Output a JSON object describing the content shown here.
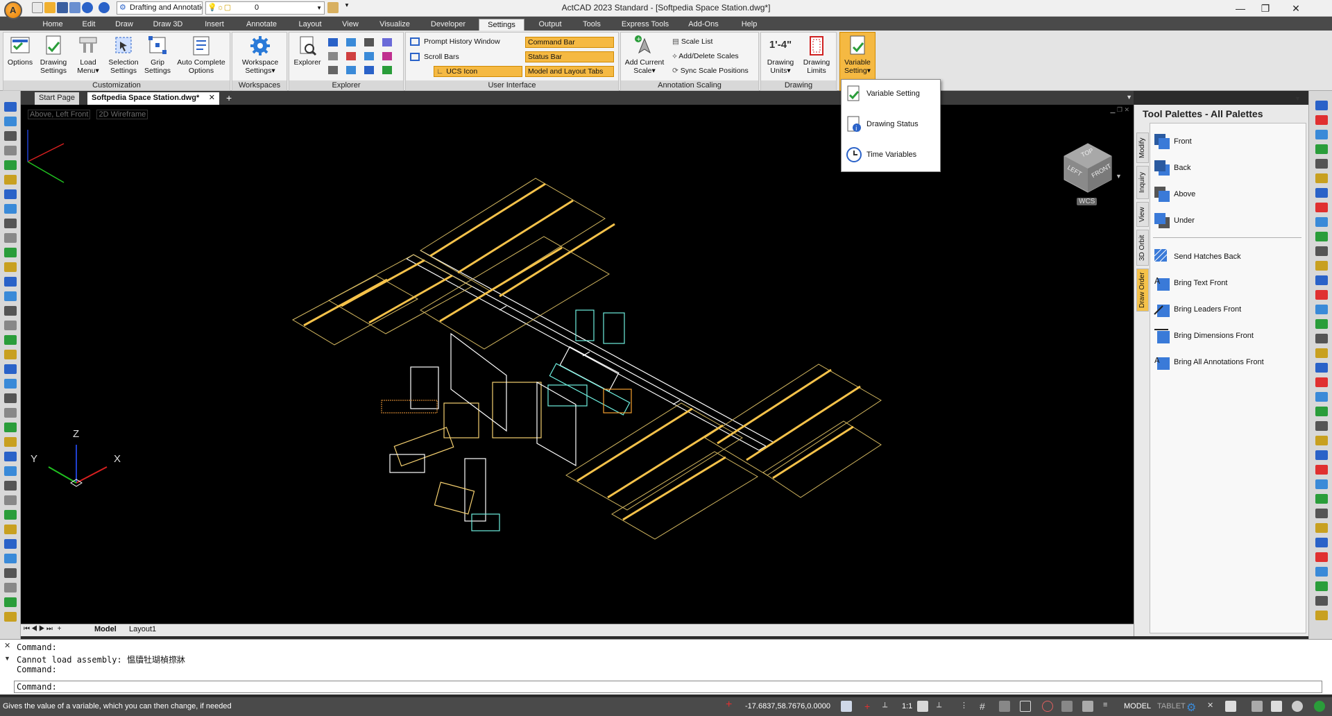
{
  "window": {
    "title": "ActCAD 2023 Standard - [Softpedia Space Station.dwg*]",
    "minimize": "—",
    "maximize": "❐",
    "close": "✕"
  },
  "quick_access": {
    "workspace_value": "Drafting and Annotation",
    "layer_value": "0"
  },
  "ribbon_tabs": [
    "Home",
    "Edit",
    "Draw",
    "Draw 3D",
    "Insert",
    "Annotate",
    "Layout",
    "View",
    "Visualize",
    "Developer",
    "Settings",
    "Output",
    "Tools",
    "Express Tools",
    "Add-Ons",
    "Help"
  ],
  "active_tab": "Settings",
  "ribbon": {
    "customization": {
      "label": "Customization",
      "buttons": [
        "Options",
        "Drawing\nSettings",
        "Load\nMenu▾",
        "Selection\nSettings",
        "Grip\nSettings",
        "Auto Complete\nOptions"
      ]
    },
    "workspaces": {
      "label": "Workspaces",
      "button": "Workspace\nSettings▾"
    },
    "explorer": {
      "label": "Explorer",
      "button": "Explorer"
    },
    "user_interface": {
      "label": "User Interface",
      "items": [
        "Prompt History Window",
        "Scroll Bars",
        "UCS Icon",
        "Command Bar",
        "Status Bar",
        "Model and Layout Tabs"
      ]
    },
    "annotation_scaling": {
      "label": "Annotation Scaling",
      "big": "Add Current\nScale▾",
      "items": [
        "Scale List",
        "Add/Delete Scales",
        "Sync Scale Positions"
      ]
    },
    "drawing": {
      "label": "Drawing",
      "units_glyph": "1'-4\"",
      "buttons": [
        "Drawing\nUnits▾",
        "Drawing\nLimits"
      ]
    },
    "variable_setting": {
      "button": "Variable\nSetting▾"
    }
  },
  "variable_menu": [
    "Variable Setting",
    "Drawing Status",
    "Time Variables"
  ],
  "doc_tabs": {
    "start": "Start Page",
    "active": "Softpedia Space Station.dwg*",
    "close": "✕",
    "add": "+"
  },
  "viewport": {
    "view_label": "Above, Left Front",
    "visual_style": "2D Wireframe",
    "viewcube": {
      "top": "TOP",
      "left": "LEFT",
      "front": "FRONT"
    },
    "wcs": "WCS",
    "axes": {
      "x": "X",
      "y": "Y",
      "z": "Z"
    }
  },
  "layout_tabs": {
    "model": "Model",
    "layout1": "Layout1"
  },
  "palette": {
    "title": "Tool Palettes - All Palettes",
    "side_tabs": [
      "Modify",
      "Inquiry",
      "View",
      "3D Orbit",
      "Draw Order"
    ],
    "items": [
      "Front",
      "Back",
      "Above",
      "Under",
      "Send Hatches Back",
      "Bring Text Front",
      "Bring Leaders Front",
      "Bring Dimensions Front",
      "Bring All Annotations Front"
    ]
  },
  "command": {
    "lines": [
      "Command:",
      "Cannot load assembly: 愠牘牡瑚楨摖牀",
      "Command:"
    ],
    "input_prefix": "Command:"
  },
  "status": {
    "hint": "Gives the value of a variable, which you can then change, if needed",
    "coords": "-17.6837,58.7676,0.0000",
    "scale": "1:1",
    "model": "MODEL",
    "tablet": "TABLET"
  },
  "colors": {
    "accent": "#f5b942",
    "ribbon_tab_bg": "#4a4a4a",
    "viewport_bg": "#000000"
  }
}
